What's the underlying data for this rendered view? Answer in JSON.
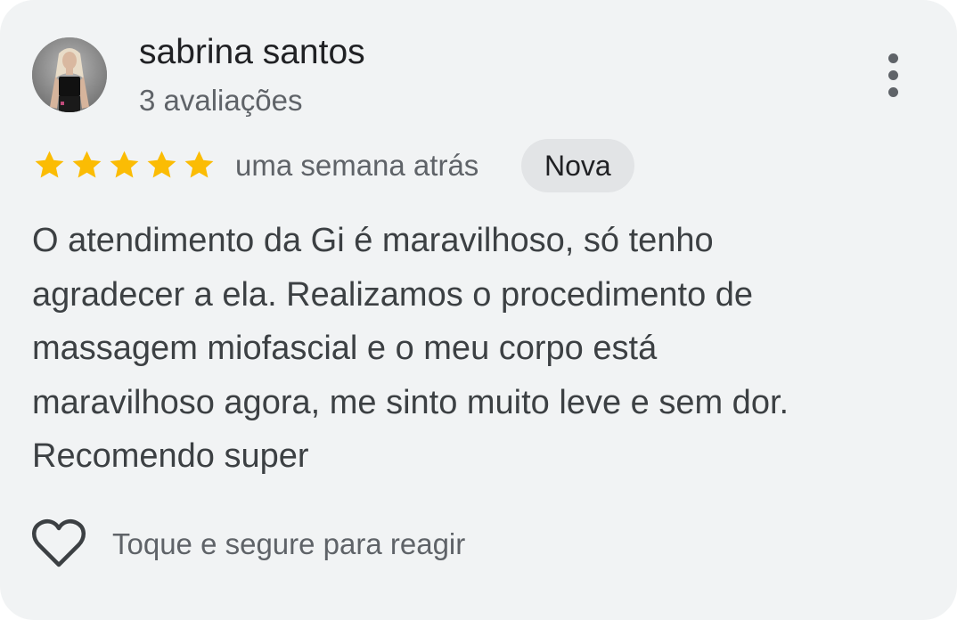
{
  "reviewer": {
    "name": "sabrina santos",
    "reviews_count": "3 avaliações"
  },
  "review": {
    "rating": 5,
    "rating_max": 5,
    "time": "uma semana atrás",
    "badge": "Nova",
    "text_lines": [
      "O atendimento da Gi é maravilhoso, só tenho",
      "agradecer a ela. Realizamos o procedimento de",
      "massagem miofascial e o meu corpo está",
      "maravilhoso agora, me sinto muito leve e sem dor.",
      "Recomendo super"
    ]
  },
  "reaction": {
    "hint": "Toque e segure para reagir",
    "icon": "heart-outline-icon"
  },
  "menu_icon": "more-vert-icon",
  "colors": {
    "star": "#fbbc04",
    "card_background": "#f1f3f4",
    "badge_background": "#e2e4e6"
  }
}
